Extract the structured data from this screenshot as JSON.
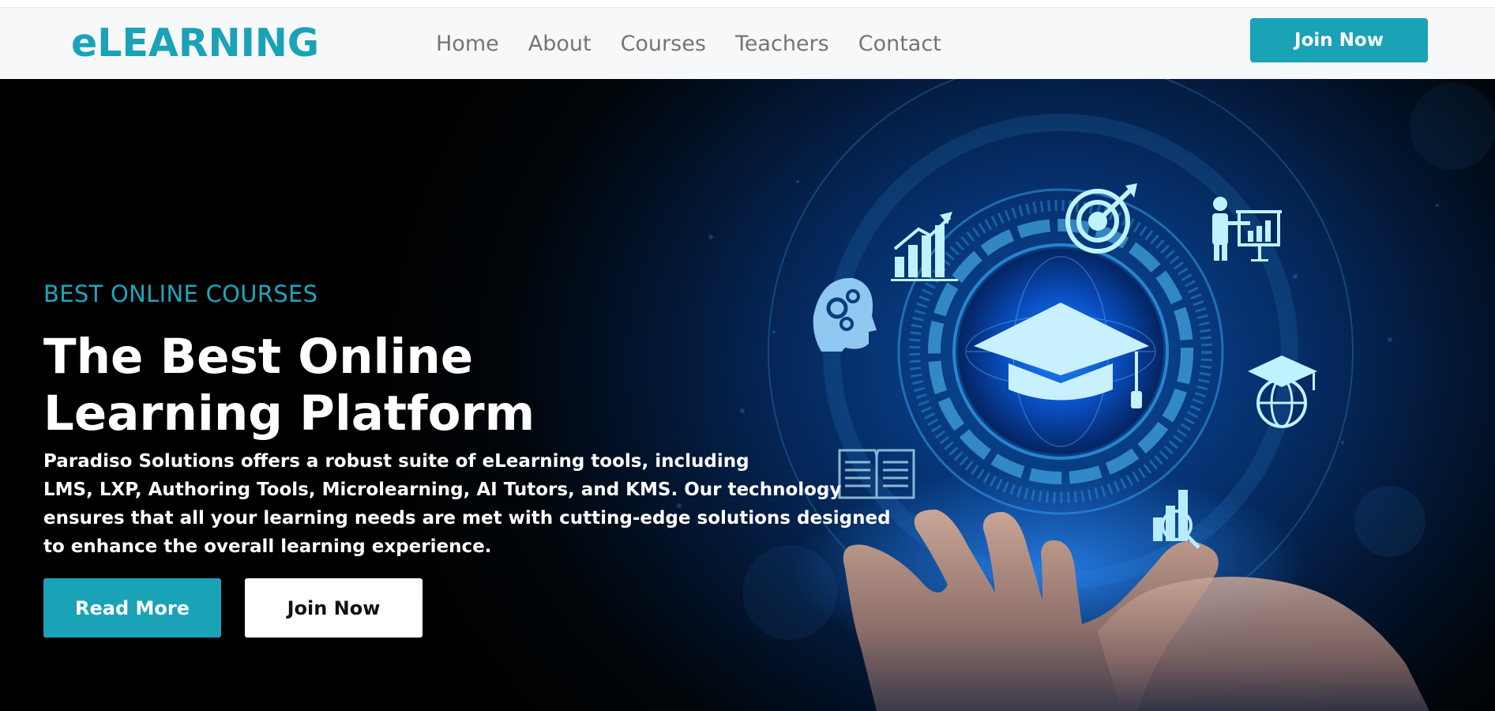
{
  "brand": {
    "name": "eLEARNING"
  },
  "nav": {
    "items": [
      {
        "label": "Home"
      },
      {
        "label": "About"
      },
      {
        "label": "Courses"
      },
      {
        "label": "Teachers"
      },
      {
        "label": "Contact"
      }
    ],
    "cta_label": "Join Now"
  },
  "hero": {
    "subtitle": "BEST ONLINE COURSES",
    "title_line1": "The Best Online",
    "title_line2": "Learning Platform",
    "description_lines": [
      "Paradiso Solutions offers a robust suite of eLearning tools, including",
      "LMS, LXP, Authoring Tools, Microlearning, AI Tutors, and KMS. Our technology",
      "ensures that all your learning needs are met with cutting-edge solutions designed",
      "to enhance the overall learning experience."
    ],
    "primary_button": "Read More",
    "secondary_button": "Join Now",
    "icons": [
      "growth-chart-icon",
      "target-icon",
      "presenter-icon",
      "brain-gears-icon",
      "graduation-cap-icon",
      "graduation-globe-icon",
      "open-book-icon",
      "analytics-search-icon"
    ]
  },
  "colors": {
    "accent": "#1aa2b7",
    "hero_bg": "#000000",
    "hero_glow": "#0a4fa0",
    "icon_glow": "#7fe6ff"
  }
}
